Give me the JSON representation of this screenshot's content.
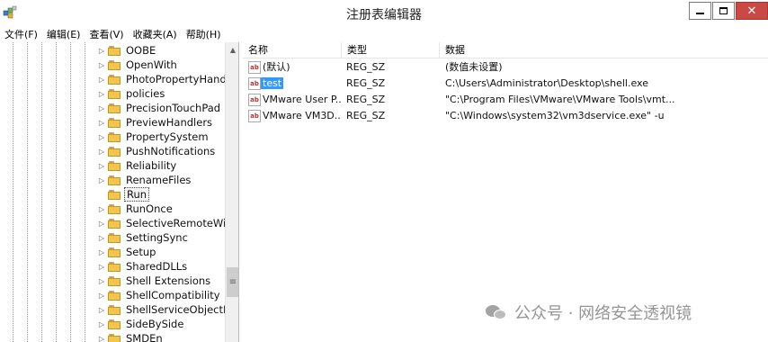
{
  "window": {
    "title": "注册表编辑器",
    "icon": "registry-editor-icon",
    "close_glyph": "✕"
  },
  "menu": {
    "file": "文件(F)",
    "edit": "编辑(E)",
    "view": "查看(V)",
    "favorites": "收藏夹(A)",
    "help": "帮助(H)"
  },
  "tree": {
    "expander_glyph": "▷",
    "items": [
      {
        "label": "OOBE"
      },
      {
        "label": "OpenWith"
      },
      {
        "label": "PhotoPropertyHandl"
      },
      {
        "label": "policies"
      },
      {
        "label": "PrecisionTouchPad"
      },
      {
        "label": "PreviewHandlers"
      },
      {
        "label": "PropertySystem"
      },
      {
        "label": "PushNotifications"
      },
      {
        "label": "Reliability"
      },
      {
        "label": "RenameFiles"
      },
      {
        "label": "Run"
      },
      {
        "label": "RunOnce"
      },
      {
        "label": "SelectiveRemoteWip"
      },
      {
        "label": "SettingSync"
      },
      {
        "label": "Setup"
      },
      {
        "label": "SharedDLLs"
      },
      {
        "label": "Shell Extensions"
      },
      {
        "label": "ShellCompatibility"
      },
      {
        "label": "ShellServiceObjectDe"
      },
      {
        "label": "SideBySide"
      },
      {
        "label": "SMDEn"
      }
    ],
    "selected": "Run"
  },
  "list": {
    "headers": {
      "name": "名称",
      "type": "类型",
      "data": "数据"
    },
    "rows": [
      {
        "name": "(默认)",
        "type": "REG_SZ",
        "data": "(数值未设置)"
      },
      {
        "name": "test",
        "type": "REG_SZ",
        "data": "C:\\Users\\Administrator\\Desktop\\shell.exe"
      },
      {
        "name": "VMware User P...",
        "type": "REG_SZ",
        "data": "\"C:\\Program Files\\VMware\\VMware Tools\\vmt..."
      },
      {
        "name": "VMware VM3D...",
        "type": "REG_SZ",
        "data": "\"C:\\Windows\\system32\\vm3dservice.exe\" -u"
      }
    ],
    "selected_row": "test",
    "value_icon_text": "ab"
  },
  "watermark": {
    "text": "公众号 · 网络安全透视镜"
  }
}
